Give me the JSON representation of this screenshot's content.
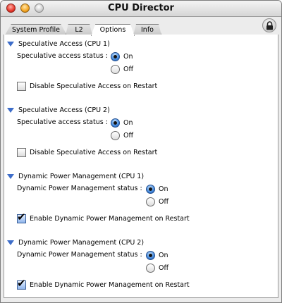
{
  "window": {
    "title": "CPU Director"
  },
  "tabs": [
    {
      "label": "System Profile"
    },
    {
      "label": "L2"
    },
    {
      "label": "Options"
    },
    {
      "label": "Info"
    }
  ],
  "sections": [
    {
      "title": "Speculative Access (CPU 1)",
      "status_label": "Speculative access status :",
      "on_label": "On",
      "off_label": "Off",
      "selected": "On",
      "checkbox_label": "Disable Speculative Access on Restart",
      "checkbox_checked": false
    },
    {
      "title": "Speculative Access (CPU 2)",
      "status_label": "Speculative access status :",
      "on_label": "On",
      "off_label": "Off",
      "selected": "On",
      "checkbox_label": "Disable Speculative Access on Restart",
      "checkbox_checked": false
    },
    {
      "title": "Dynamic Power Management (CPU 1)",
      "status_label": "Dynamic Power Management status :",
      "on_label": "On",
      "off_label": "Off",
      "selected": "On",
      "checkbox_label": "Enable Dynamic Power Management on Restart",
      "checkbox_checked": true
    },
    {
      "title": "Dynamic Power Management (CPU 2)",
      "status_label": "Dynamic Power Management status :",
      "on_label": "On",
      "off_label": "Off",
      "selected": "On",
      "checkbox_label": "Enable Dynamic Power Management on Restart",
      "checkbox_checked": true
    }
  ],
  "icons": {
    "lock": "lock-icon",
    "disclosure": "disclosure-triangle-icon",
    "checkmark": "checkmark-icon"
  },
  "colors": {
    "accent": "#3d6dc9",
    "radio_selected": "#4a8fe0"
  }
}
